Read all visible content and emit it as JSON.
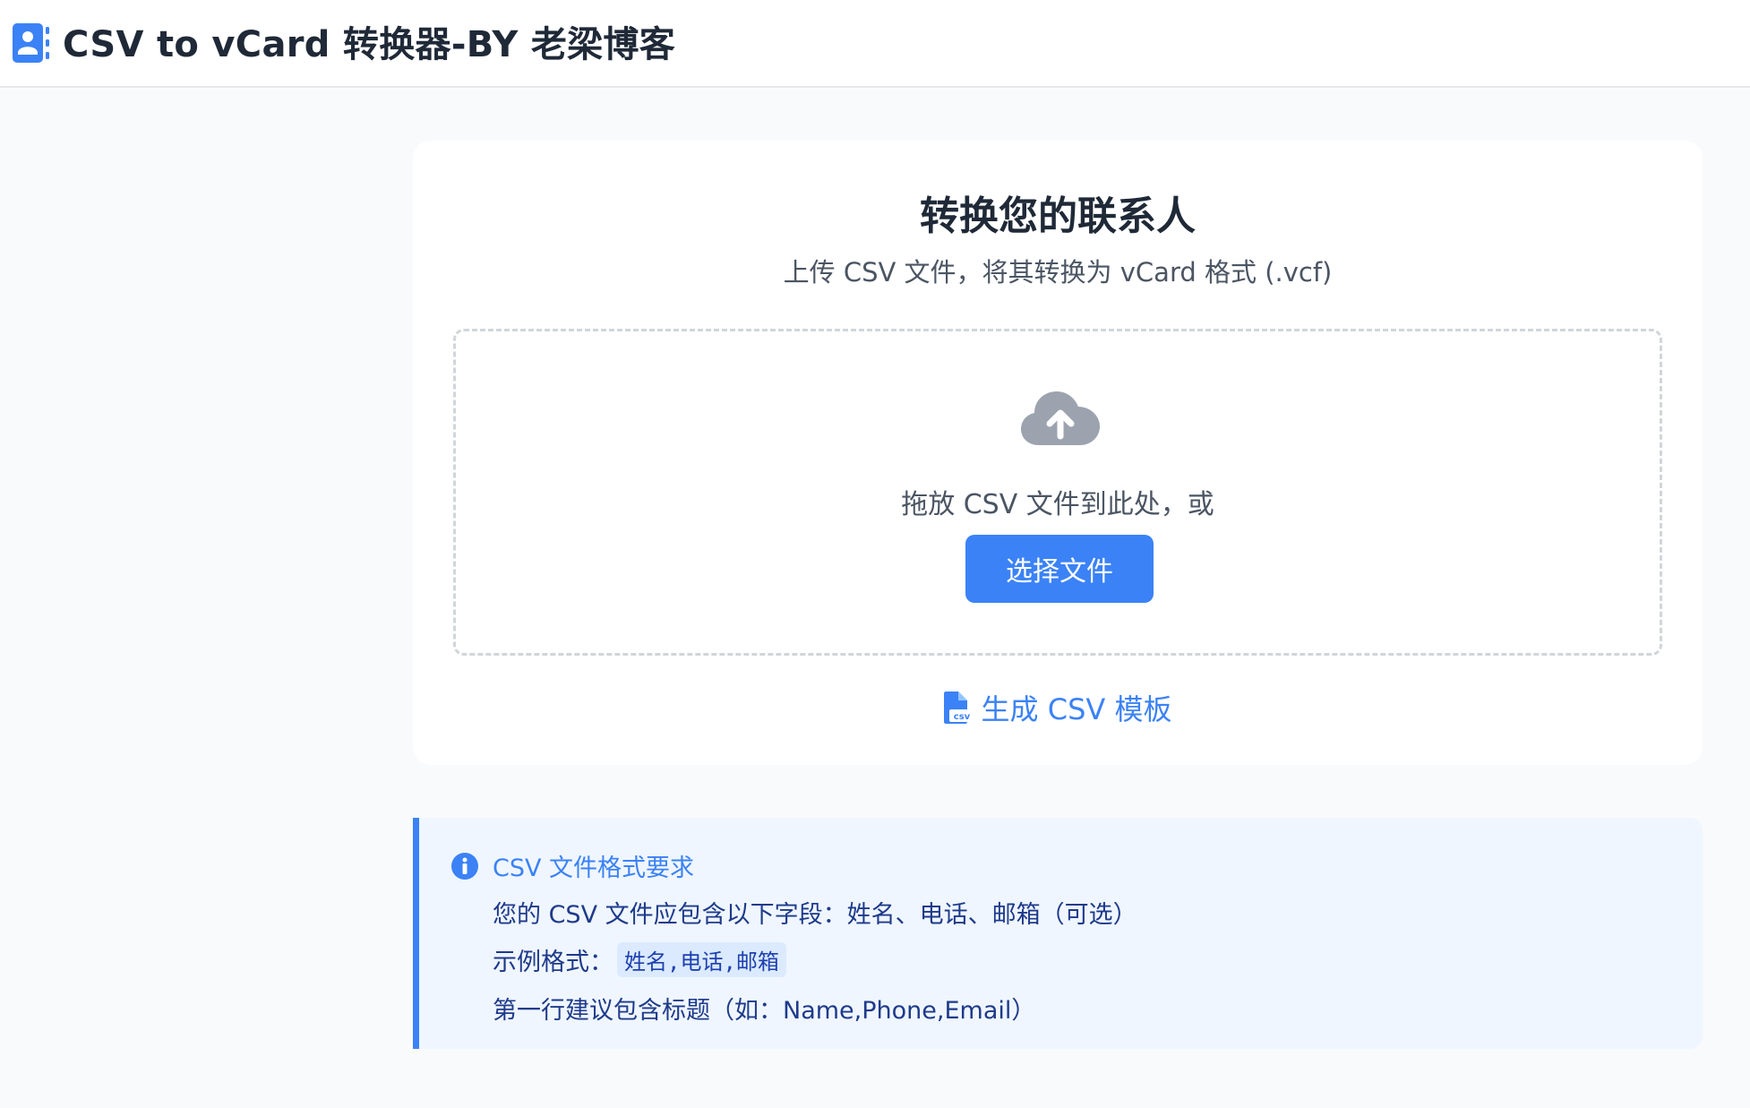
{
  "header": {
    "title": "CSV to vCard 转换器-BY 老梁博客",
    "icon": "address-book-icon"
  },
  "converter": {
    "title": "转换您的联系人",
    "subtitle": "上传 CSV 文件，将其转换为 vCard 格式 (.vcf)",
    "dropzone": {
      "icon": "cloud-upload-icon",
      "text": "拖放 CSV 文件到此处，或",
      "button_label": "选择文件"
    },
    "template_link": {
      "icon": "csv-file-icon",
      "label": "生成 CSV 模板"
    }
  },
  "info": {
    "icon": "info-circle-icon",
    "title": "CSV 文件格式要求",
    "line1": "您的 CSV 文件应包含以下字段：姓名、电话、邮箱（可选）",
    "example_label": "示例格式：",
    "example_code": "姓名,电话,邮箱",
    "line3": "第一行建议包含标题（如：Name,Phone,Email）"
  },
  "colors": {
    "accent": "#3b82f6",
    "info_bg": "#eff6ff",
    "info_text": "#1e3a8a",
    "page_bg": "#f9fafb"
  }
}
